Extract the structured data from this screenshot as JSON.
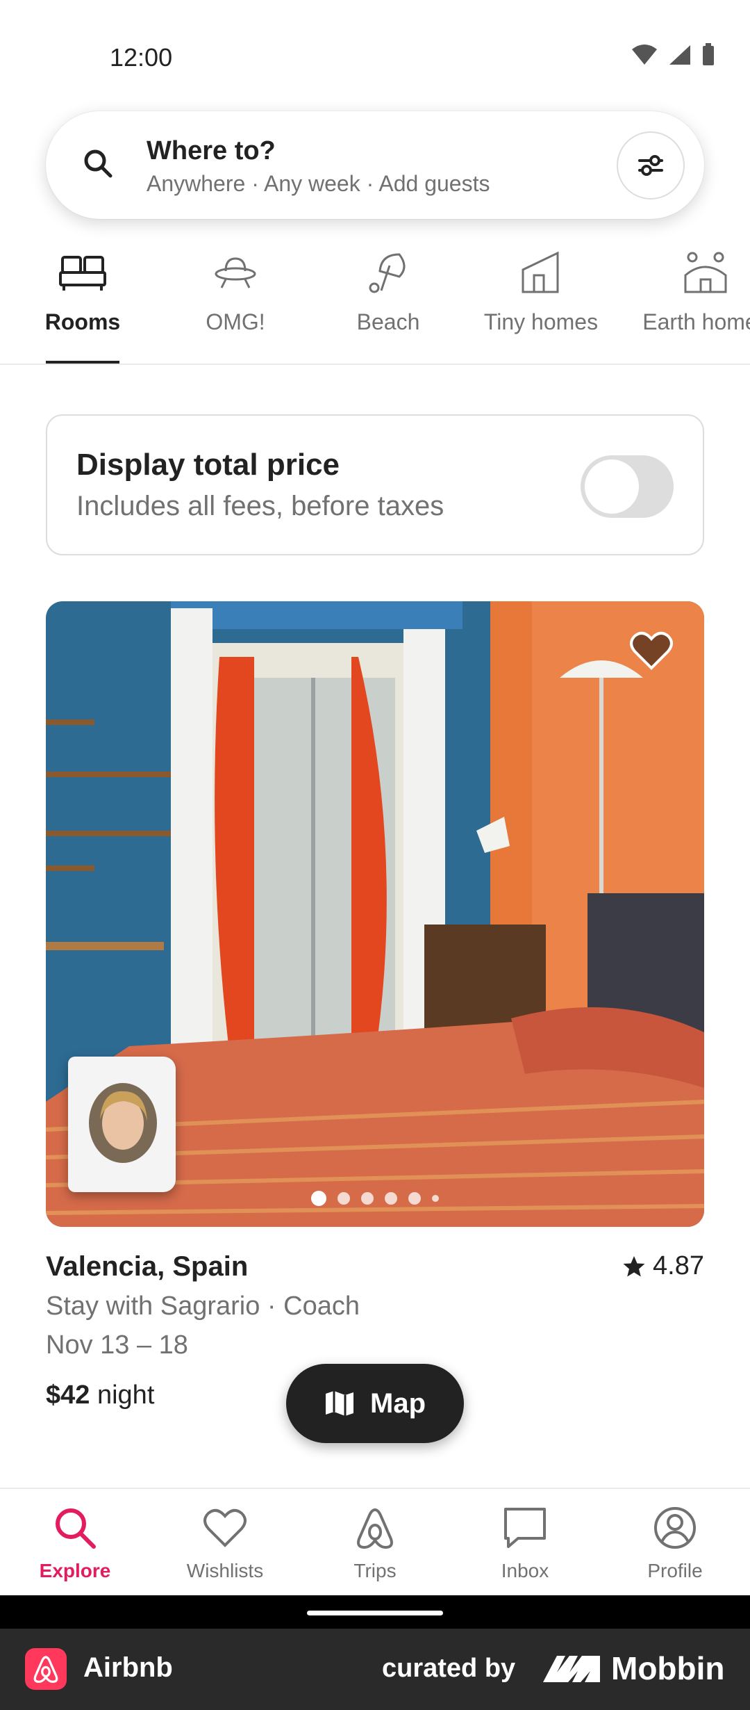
{
  "status_bar": {
    "time": "12:00"
  },
  "search": {
    "title": "Where to?",
    "subtitle": "Anywhere · Any week · Add guests"
  },
  "categories": [
    {
      "label": "Rooms",
      "icon": "bed-icon",
      "active": true
    },
    {
      "label": "OMG!",
      "icon": "ufo-icon",
      "active": false
    },
    {
      "label": "Beach",
      "icon": "umbrella-icon",
      "active": false
    },
    {
      "label": "Tiny homes",
      "icon": "tiny-home-icon",
      "active": false
    },
    {
      "label": "Earth homes",
      "icon": "earth-home-icon",
      "active": false
    }
  ],
  "price_toggle": {
    "title": "Display total price",
    "subtitle": "Includes all fees, before taxes",
    "enabled": false
  },
  "listing": {
    "location": "Valencia, Spain",
    "rating": "4.87",
    "host_line": "Stay with Sagrario · Coach",
    "dates": "Nov 13 – 18",
    "price": "$42",
    "price_unit": "night",
    "photo_count": 6,
    "active_photo_index": 0
  },
  "map_button": {
    "label": "Map"
  },
  "bottom_nav": [
    {
      "label": "Explore",
      "icon": "search-icon",
      "active": true
    },
    {
      "label": "Wishlists",
      "icon": "heart-icon",
      "active": false
    },
    {
      "label": "Trips",
      "icon": "airbnb-icon",
      "active": false
    },
    {
      "label": "Inbox",
      "icon": "message-icon",
      "active": false
    },
    {
      "label": "Profile",
      "icon": "profile-icon",
      "active": false
    }
  ],
  "footer": {
    "app_name": "Airbnb",
    "curated_by": "curated by",
    "brand": "Mobbin"
  },
  "colors": {
    "accent": "#e31c5f",
    "brand": "#ff385c",
    "text_primary": "#222222",
    "text_secondary": "#717171"
  }
}
